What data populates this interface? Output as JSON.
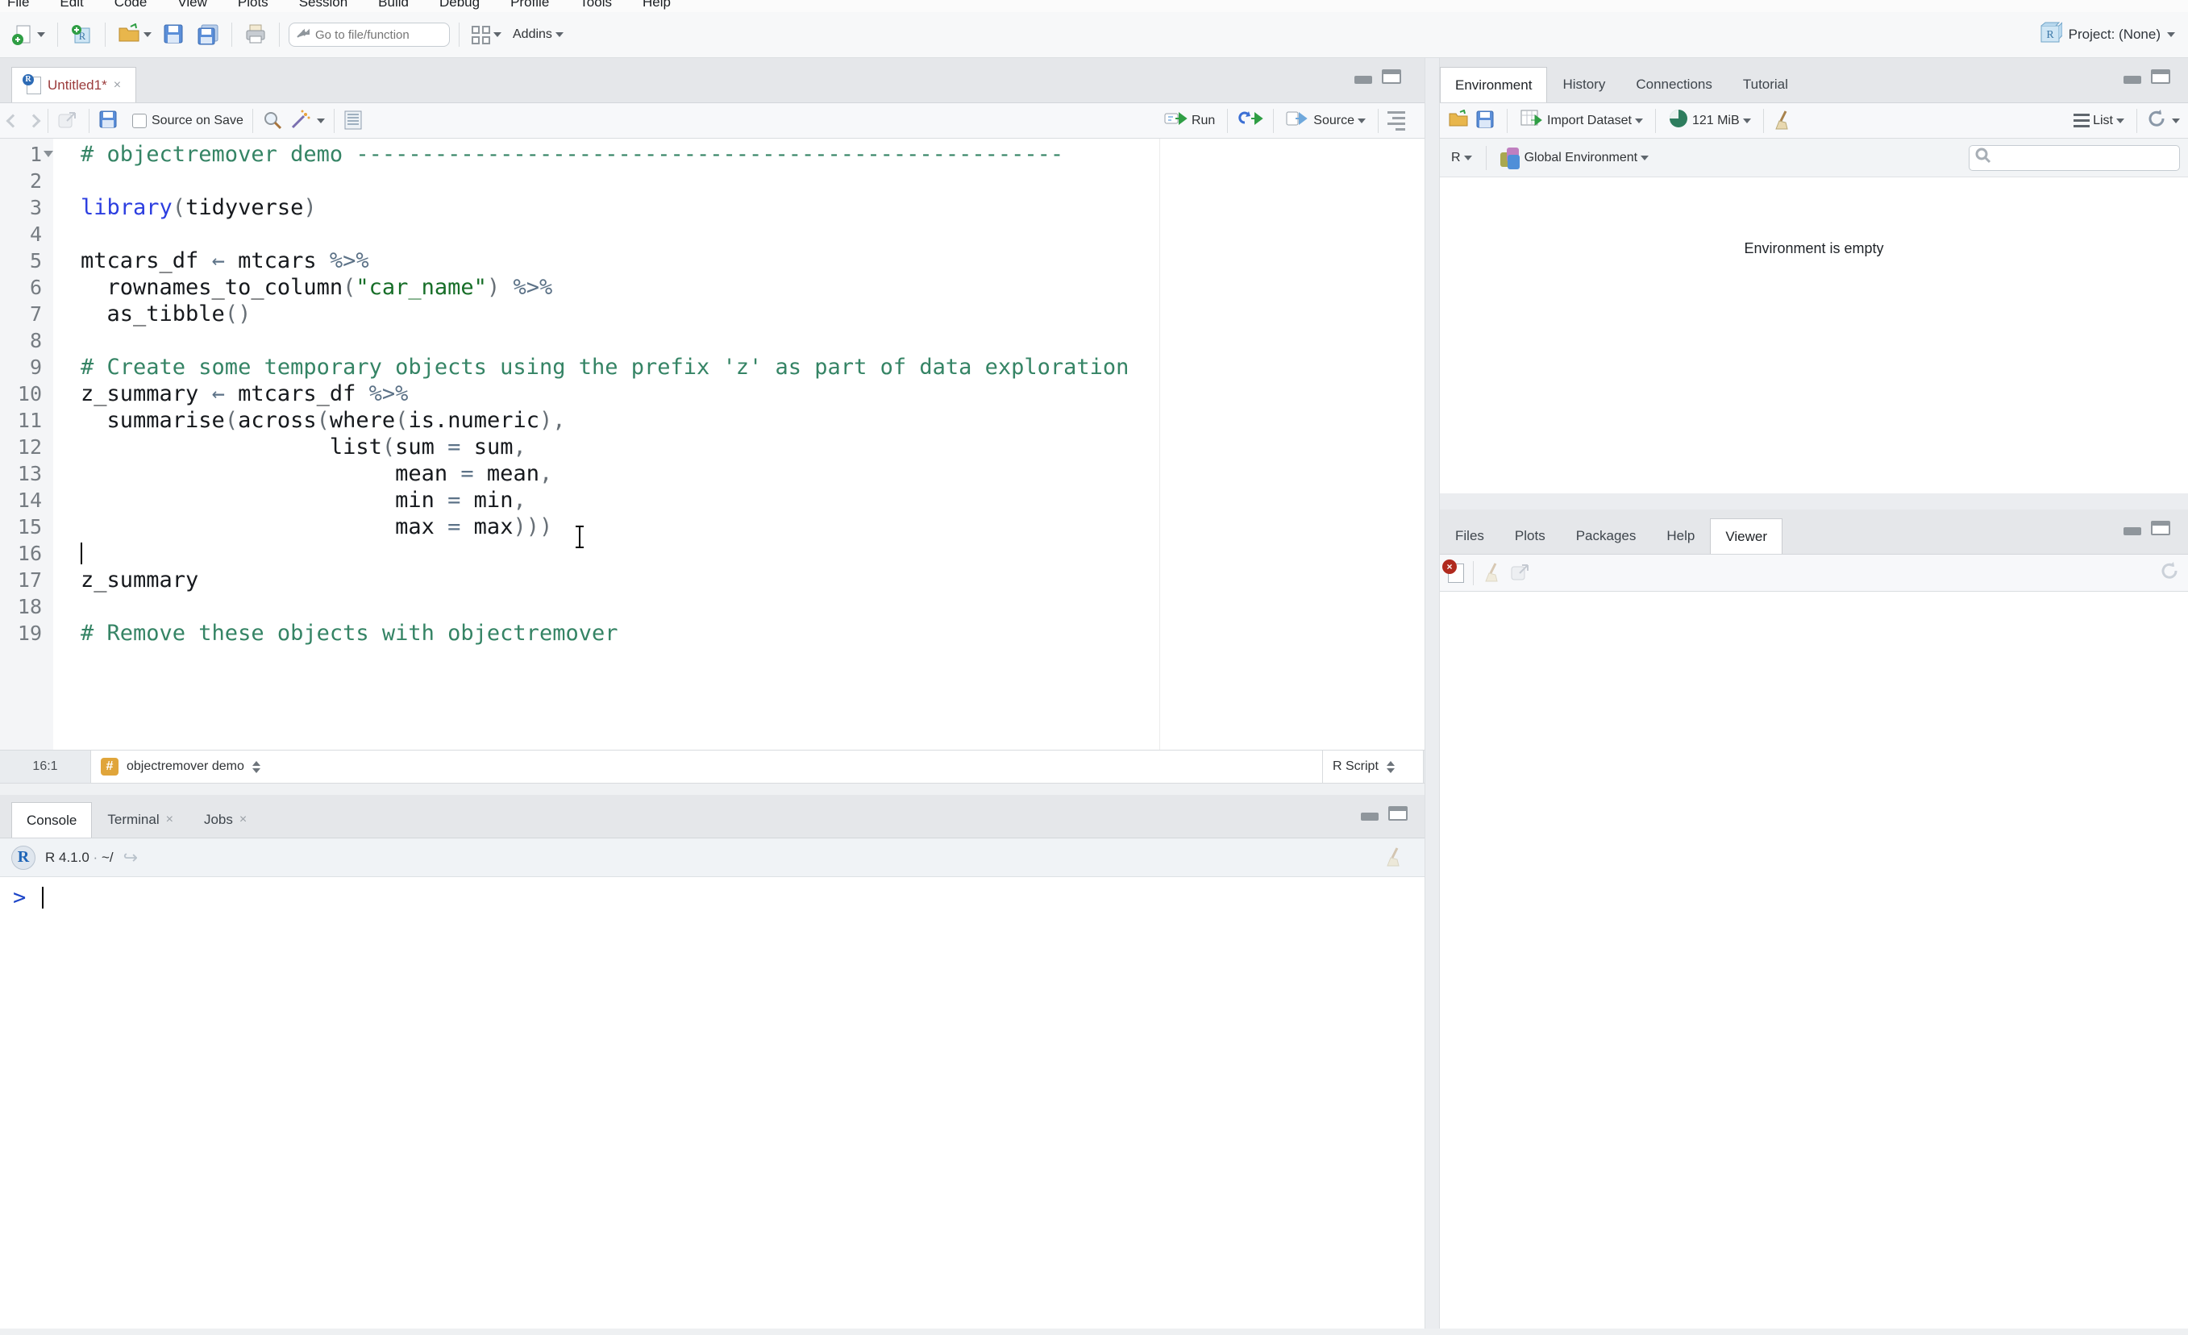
{
  "colors": {
    "accent_blue": "#2c3ee0",
    "comment_green": "#358465",
    "string_green": "#176e28",
    "operator_slate": "#5c7287",
    "modified_tab_red": "#9b3c3c",
    "section_badge_orange": "#e0a53a",
    "prompt_blue": "#1d46c8",
    "chrome_gray": "#e5e7ea"
  },
  "menu": {
    "items": [
      "File",
      "Edit",
      "Code",
      "View",
      "Plots",
      "Session",
      "Build",
      "Debug",
      "Profile",
      "Tools",
      "Help"
    ]
  },
  "toolbar": {
    "icons": [
      "new-file-icon",
      "new-project-icon",
      "open-folder-icon",
      "save-icon",
      "save-all-icon",
      "print-icon",
      "goto-arrow-icon",
      "pane-layout-grid-icon"
    ],
    "goto_placeholder": "Go to file/function",
    "addins_label": "Addins",
    "project_label": "Project: (None)"
  },
  "source_pane": {
    "tab": {
      "title": "Untitled1*",
      "close": "×"
    },
    "toolbar": {
      "source_on_save": "Source on Save",
      "run_label": "Run",
      "source_label": "Source"
    },
    "status": {
      "position": "16:1",
      "section": "objectremover demo",
      "file_type": "R Script"
    },
    "cursor": {
      "line": 16,
      "column": 1
    },
    "code": {
      "lines": [
        {
          "n": 1,
          "fold": true,
          "segs": [
            [
              "sc",
              "# objectremover demo ------------------------------------------------------"
            ]
          ]
        },
        {
          "n": 2,
          "segs": []
        },
        {
          "n": 3,
          "segs": [
            [
              "sk",
              "library"
            ],
            [
              "sp",
              "("
            ],
            [
              "st",
              "tidyverse"
            ],
            [
              "sp",
              ")"
            ]
          ]
        },
        {
          "n": 4,
          "segs": []
        },
        {
          "n": 5,
          "segs": [
            [
              "st",
              "mtcars_df "
            ],
            [
              "so",
              "←"
            ],
            [
              "st",
              " mtcars "
            ],
            [
              "so",
              "%>%"
            ]
          ]
        },
        {
          "n": 6,
          "segs": [
            [
              "st",
              "  rownames_to_column"
            ],
            [
              "sp",
              "("
            ],
            [
              "ss",
              "\"car_name\""
            ],
            [
              "sp",
              ") "
            ],
            [
              "so",
              "%>%"
            ]
          ]
        },
        {
          "n": 7,
          "segs": [
            [
              "st",
              "  as_tibble"
            ],
            [
              "sp",
              "()"
            ]
          ]
        },
        {
          "n": 8,
          "segs": []
        },
        {
          "n": 9,
          "segs": [
            [
              "sc",
              "# Create some temporary objects using the prefix 'z' as part of data exploration"
            ]
          ]
        },
        {
          "n": 10,
          "segs": [
            [
              "st",
              "z_summary "
            ],
            [
              "so",
              "←"
            ],
            [
              "st",
              " mtcars_df "
            ],
            [
              "so",
              "%>%"
            ]
          ]
        },
        {
          "n": 11,
          "segs": [
            [
              "st",
              "  summarise"
            ],
            [
              "sp",
              "("
            ],
            [
              "st",
              "across"
            ],
            [
              "sp",
              "("
            ],
            [
              "st",
              "where"
            ],
            [
              "sp",
              "("
            ],
            [
              "st",
              "is.numeric"
            ],
            [
              "sp",
              "),"
            ]
          ]
        },
        {
          "n": 12,
          "segs": [
            [
              "st",
              "                   list"
            ],
            [
              "sp",
              "("
            ],
            [
              "st",
              "sum "
            ],
            [
              "so",
              "="
            ],
            [
              "st",
              " sum"
            ],
            [
              "sp",
              ","
            ]
          ]
        },
        {
          "n": 13,
          "segs": [
            [
              "st",
              "                        mean "
            ],
            [
              "so",
              "="
            ],
            [
              "st",
              " mean"
            ],
            [
              "sp",
              ","
            ]
          ]
        },
        {
          "n": 14,
          "segs": [
            [
              "st",
              "                        min "
            ],
            [
              "so",
              "="
            ],
            [
              "st",
              " min"
            ],
            [
              "sp",
              ","
            ]
          ]
        },
        {
          "n": 15,
          "segs": [
            [
              "st",
              "                        max "
            ],
            [
              "so",
              "="
            ],
            [
              "st",
              " max"
            ],
            [
              "sp",
              ")))"
            ]
          ]
        },
        {
          "n": 16,
          "segs": []
        },
        {
          "n": 17,
          "segs": [
            [
              "st",
              "z_summary"
            ]
          ]
        },
        {
          "n": 18,
          "segs": []
        },
        {
          "n": 19,
          "segs": [
            [
              "sc",
              "# Remove these objects with objectremover"
            ]
          ]
        }
      ]
    }
  },
  "console_pane": {
    "tabs": [
      {
        "label": "Console",
        "active": true
      },
      {
        "label": "Terminal",
        "closable": true
      },
      {
        "label": "Jobs",
        "closable": true
      }
    ],
    "header": {
      "version": "R 4.1.0",
      "separator": "·",
      "path": "~/"
    },
    "prompt": ">"
  },
  "environment_pane": {
    "tabs": [
      {
        "label": "Environment",
        "active": true
      },
      {
        "label": "History"
      },
      {
        "label": "Connections"
      },
      {
        "label": "Tutorial"
      }
    ],
    "toolbar": {
      "import_label": "Import Dataset",
      "memory_label": "121 MiB",
      "list_label": "List"
    },
    "scope": {
      "language": "R",
      "environment": "Global Environment"
    },
    "empty_text": "Environment is empty",
    "icons": [
      "open-workspace-icon",
      "save-workspace-icon",
      "import-dataset-icon",
      "memory-usage-icon",
      "broom-icon",
      "list-view-icon",
      "refresh-icon",
      "global-env-cube-icon",
      "search-icon"
    ]
  },
  "files_pane": {
    "tabs": [
      {
        "label": "Files"
      },
      {
        "label": "Plots"
      },
      {
        "label": "Packages"
      },
      {
        "label": "Help"
      },
      {
        "label": "Viewer",
        "active": true
      }
    ],
    "icons": [
      "clear-viewer-icon",
      "broom-icon",
      "popout-icon",
      "refresh-icon"
    ]
  }
}
